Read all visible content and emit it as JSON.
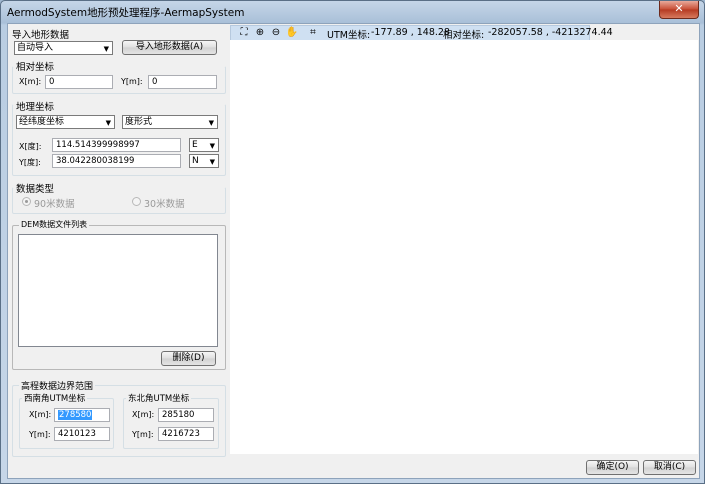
{
  "window": {
    "title": "AermodSystem地形预处理程序-AermapSystem",
    "close_label": "✕"
  },
  "import": {
    "group_title": "导入地形数据",
    "mode_value": "自动导入",
    "import_button": "导入地形数据(A)"
  },
  "relative": {
    "group_title": "相对坐标",
    "x_label": "X[m]:",
    "x_value": "0",
    "y_label": "Y[m]:",
    "y_value": "0"
  },
  "geo": {
    "group_title": "地理坐标",
    "system_value": "经纬度坐标",
    "format_value": "度形式",
    "x_label": "X[度]:",
    "x_value": "114.514399998997",
    "x_dir": "E",
    "y_label": "Y[度]:",
    "y_value": "38.042280038199",
    "y_dir": "N"
  },
  "datatype": {
    "group_title": "数据类型",
    "option_90": "90米数据",
    "option_30": "30米数据"
  },
  "dem": {
    "group_title": "DEM数据文件列表",
    "delete_button": "删除(D)"
  },
  "bounds": {
    "group_title": "高程数据边界范围",
    "sw_title": "西南角UTM坐标",
    "sw_x_label": "X[m]:",
    "sw_x_value": "278580",
    "sw_y_label": "Y[m]:",
    "sw_y_value": "4210123",
    "ne_title": "东北角UTM坐标",
    "ne_x_label": "X[m]:",
    "ne_x_value": "285180",
    "ne_y_label": "Y[m]:",
    "ne_y_value": "4216723"
  },
  "status": {
    "utm_label": "UTM坐标:",
    "utm_value": "-177.89 , 148.28",
    "rel_label": "相对坐标:",
    "rel_value": "-282057.58 , -4213274.44"
  },
  "footer": {
    "ok_button": "确定(O)",
    "cancel_button": "取消(C)"
  }
}
